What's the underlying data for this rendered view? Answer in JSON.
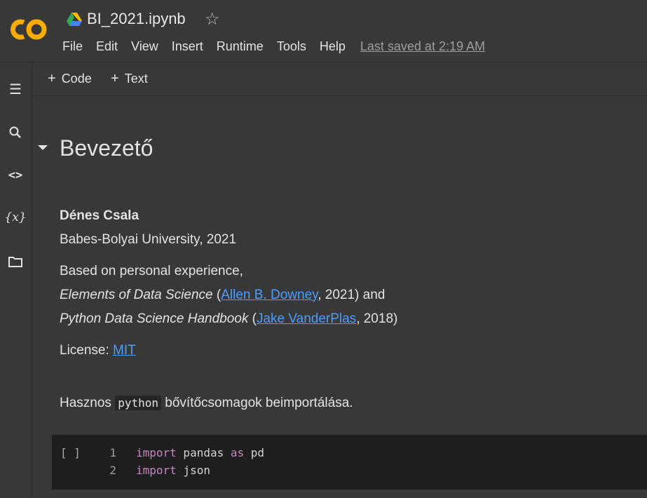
{
  "header": {
    "logo": "CO",
    "drive_icon": "google-drive-icon",
    "title": "BI_2021.ipynb",
    "star_icon": "☆",
    "menu": [
      "File",
      "Edit",
      "View",
      "Insert",
      "Runtime",
      "Tools",
      "Help"
    ],
    "last_saved": "Last saved at 2:19 AM"
  },
  "rail": {
    "toc_icon": "☰",
    "search_icon": "search-icon",
    "code_icon": "<>",
    "variables_icon": "{x}",
    "files_icon": "folder-icon"
  },
  "toolbar": {
    "plus": "+",
    "code_label": "Code",
    "text_label": "Text"
  },
  "main": {
    "heading": "Bevezető",
    "author": "Dénes Csala",
    "affiliation": "Babes-Bolyai University, 2021",
    "based_on": "Based on personal experience,",
    "book1": {
      "title": "Elements of Data Science",
      "open": " (",
      "author": "Allen B. Downey",
      "rest": ", 2021) and"
    },
    "book2": {
      "title": "Python Data Science Handbook",
      "open": " (",
      "author": "Jake VanderPlas",
      "rest": ", 2018)"
    },
    "license_label": "License: ",
    "license_link": "MIT",
    "useful_before": "Hasznos ",
    "useful_code": "python",
    "useful_after": " bővítőcsomagok beimportálása."
  },
  "code_cell": {
    "run_label": "[ ]",
    "lines": [
      {
        "num": "1",
        "kw1": "import",
        "mid": " pandas ",
        "kw2": "as",
        "end": " pd"
      },
      {
        "num": "2",
        "kw1": "import",
        "mid": " json",
        "kw2": "",
        "end": ""
      }
    ]
  },
  "colors": {
    "background": "#383838",
    "link": "#4a9eff",
    "keyword": "#c586c0",
    "code_bg": "#1e1e1e",
    "logo_orange": "#f9ab00"
  }
}
